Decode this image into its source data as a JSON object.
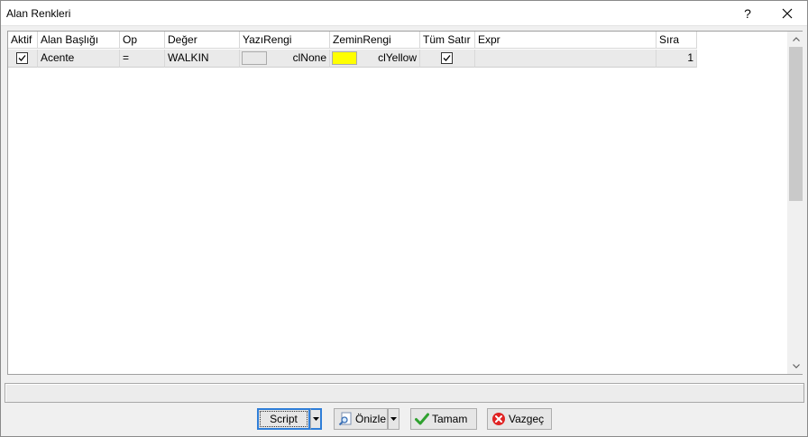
{
  "window": {
    "title": "Alan Renkleri",
    "help_label": "?"
  },
  "colors": {
    "accent": "#2f7ed8",
    "yellow": "#ffff00",
    "row_bg": "#eaeaea"
  },
  "grid": {
    "columns": [
      "Aktif",
      "Alan Başlığı",
      "Op",
      "Değer",
      "YazıRengi",
      "ZeminRengi",
      "Tüm Satır",
      "Expr",
      "Sıra"
    ],
    "rows": [
      {
        "aktif": true,
        "alan_basligi": "Acente",
        "op": "=",
        "deger": "WALKIN",
        "yazi_rengi": {
          "swatch": "#e8e8e8",
          "name": "clNone"
        },
        "zemin_rengi": {
          "swatch": "#ffff00",
          "name": "clYellow"
        },
        "tum_satir": true,
        "expr": "",
        "sira": "1"
      }
    ]
  },
  "buttons": {
    "script": "Script",
    "preview": "Önizle",
    "ok": "Tamam",
    "cancel": "Vazgeç"
  },
  "icons": {
    "help": "question-mark",
    "close": "close-icon",
    "preview": "magnifier-document-icon",
    "ok": "green-check-icon",
    "cancel": "red-x-icon"
  }
}
